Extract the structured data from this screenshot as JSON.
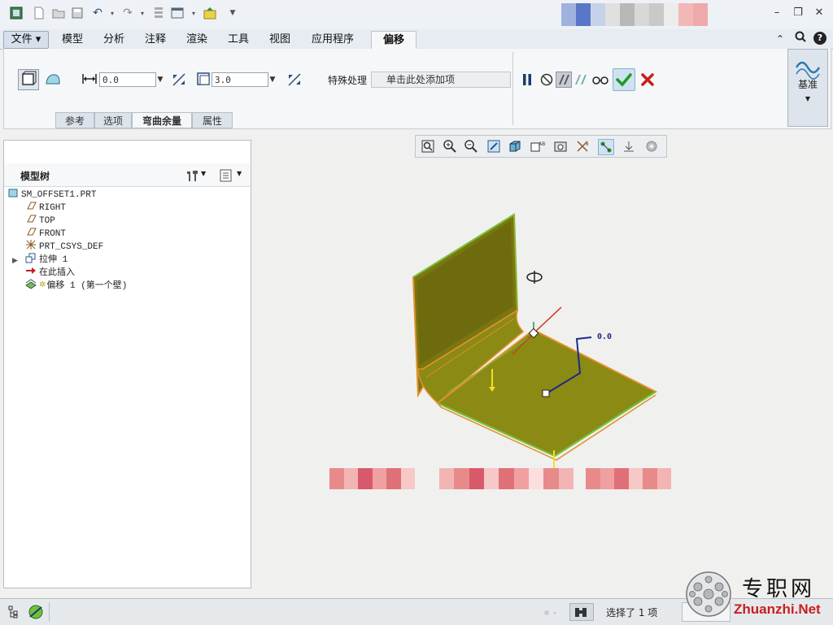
{
  "quick_access": {
    "icons": [
      "app-icon",
      "new-icon",
      "open-icon",
      "save-icon",
      "undo-icon",
      "redo-icon",
      "regenerate-icon",
      "windows-icon",
      "close-window-icon",
      "customize-icon"
    ]
  },
  "tabs": [
    {
      "id": "file",
      "label": "文件 ▾"
    },
    {
      "id": "model",
      "label": "模型"
    },
    {
      "id": "analysis",
      "label": "分析"
    },
    {
      "id": "annotate",
      "label": "注释"
    },
    {
      "id": "render",
      "label": "渲染"
    },
    {
      "id": "tools",
      "label": "工具"
    },
    {
      "id": "view",
      "label": "视图"
    },
    {
      "id": "apps",
      "label": "应用程序"
    },
    {
      "id": "offset",
      "label": "偏移"
    }
  ],
  "ribbon": {
    "offset_value": "0.0",
    "thickness_value": "3.0",
    "special_label": "特殊处理",
    "special_placeholder": "单击此处添加项",
    "datum_label": "基准"
  },
  "subtabs": [
    "参考",
    "选项",
    "弯曲余量",
    "属性"
  ],
  "model_tree": {
    "title": "模型树",
    "items": [
      {
        "label": "SM_OFFSET1.PRT",
        "icon": "part-icon"
      },
      {
        "label": "RIGHT",
        "icon": "datum-plane-icon"
      },
      {
        "label": "TOP",
        "icon": "datum-plane-icon"
      },
      {
        "label": "FRONT",
        "icon": "datum-plane-icon"
      },
      {
        "label": "PRT_CSYS_DEF",
        "icon": "csys-icon"
      },
      {
        "label": "拉伸 1",
        "icon": "extrude-icon"
      },
      {
        "label": "在此插入",
        "icon": "insert-arrow-icon"
      },
      {
        "label": "偏移 1 (第一个壁)",
        "icon": "offset-wall-icon"
      }
    ]
  },
  "viewport": {
    "dimension_label": "0.0"
  },
  "status": {
    "selection_text": "选择了 1 项"
  },
  "watermark": {
    "cn": "专职网",
    "en": "Zhuanzhi.Net"
  },
  "colors": {
    "part_fill": "#8b8a14",
    "edge_highlight": "#e0902a",
    "edge_green": "#6fc23a",
    "accept": "#1f9a1f",
    "cancel": "#c81e1e"
  }
}
